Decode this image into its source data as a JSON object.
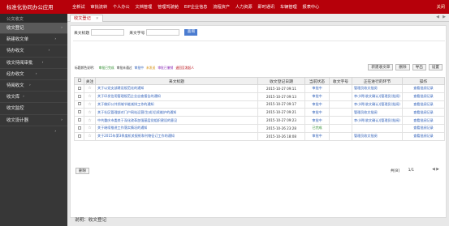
{
  "app": {
    "title": "标准化协同办公应用",
    "user": "关闭"
  },
  "top_nav": [
    "全新试",
    "审批流转",
    "个人办公",
    "文档管理",
    "管理驾驶舱",
    "EIP企业信息",
    "流程资产",
    "人力资源",
    "即时通讯",
    "车辆管理",
    "报表中心"
  ],
  "sidebar": {
    "header": "公文收文",
    "items": [
      {
        "label": "收文登记",
        "selected": true
      },
      {
        "label": "新建收文单",
        "selected": false
      },
      {
        "label": "待办收文",
        "selected": false
      },
      {
        "label": "收文待阅审批",
        "selected": false
      },
      {
        "label": "经办收文",
        "selected": false
      },
      {
        "label": "待阅收文",
        "selected": false
      },
      {
        "label": "收文库",
        "selected": false
      },
      {
        "label": "收文监控",
        "selected": false
      },
      {
        "label": "收文设计器",
        "selected": false
      }
    ]
  },
  "tab": {
    "label": "收文登记"
  },
  "filter": {
    "label1": "来文标题",
    "label2": "来文字号",
    "search_button": "查询"
  },
  "legend": {
    "prefix": "标题颜色说明：",
    "items": [
      {
        "text": "审批已完成",
        "color": "#2a8a2a"
      },
      {
        "text": "审批未通过",
        "color": "#333333"
      },
      {
        "text": "审批中",
        "color": "#2a5cb8"
      },
      {
        "text": "未发送",
        "color": "#d48a00"
      },
      {
        "text": "审批已撤销",
        "color": "#8a2ab8"
      },
      {
        "text": "退回至发起人",
        "color": "#b6000a"
      }
    ]
  },
  "toolbar": [
    "新建收文单",
    "删除",
    "导出",
    "设置"
  ],
  "table": {
    "columns": [
      "",
      "关注",
      "来文标题",
      "收文登记日期",
      "当前状态",
      "收文字号",
      "正在进行的环节",
      "操作"
    ],
    "rows": [
      {
        "title": "关于以党支部建设规范化的通知",
        "date": "2015-10-27 09:11",
        "status": "审批中",
        "number": "",
        "step": "管理员收文批阅",
        "op": "查看批阅记录"
      },
      {
        "title": "关于印发信用管理规范企业自查报告的通知",
        "date": "2015-10-27 09:13",
        "status": "审批中",
        "number": "",
        "step": "李小明(收文确认)|管理员(批阅)",
        "op": "查看批阅记录"
      },
      {
        "title": "关于做好公共领域节能减排工作的通知",
        "date": "2015-10-27 09:17",
        "status": "审批中",
        "number": "",
        "step": "李小明(收文确认)|管理员(批阅)",
        "op": "查看批阅记录"
      },
      {
        "title": "关于社区管理部对门户网站运营(生成)后续维护的通知",
        "date": "2015-10-27 09:21",
        "status": "审批中",
        "number": "",
        "step": "管理员收文批阅",
        "op": "查看批阅记录"
      },
      {
        "title": "中共重庆市委关于深化改革加强基层党组织建设的意见",
        "date": "2015-10-27 09:23",
        "status": "审批中",
        "number": "",
        "step": "李小明(收文确认)|管理员(批阅)",
        "op": "查看批阅记录"
      },
      {
        "title": "关于继续推进工作落实情况的通知",
        "date": "2015-10-26 23:28",
        "status": "已完成",
        "number": "",
        "step": "",
        "op": "查看批阅记录"
      },
      {
        "title": "关于2015年第3季度机关报纸和刊物征订工作的通知",
        "date": "2015-10-26 18:08",
        "status": "审批中",
        "number": "",
        "step": "管理员收文批阅",
        "op": "查看批阅记录"
      }
    ]
  },
  "pagination": {
    "delete_button": "删除",
    "info": "共[8]",
    "page": "1/1",
    "nav": "◀ ▶"
  },
  "footer": {
    "text": "说明：收文登记"
  }
}
